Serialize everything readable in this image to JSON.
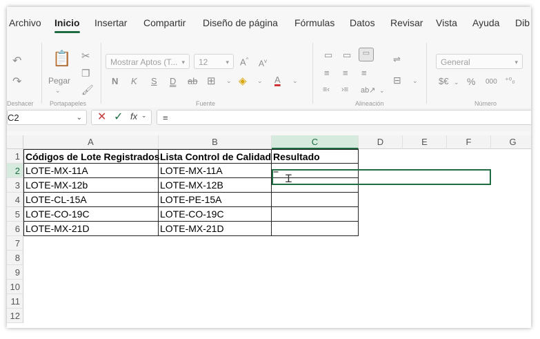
{
  "tabs": [
    "Archivo",
    "Inicio",
    "Insertar",
    "Compartir",
    "Diseño de página",
    "Fórmulas",
    "Datos",
    "Revisar",
    "Vista",
    "Ayuda",
    "Dib"
  ],
  "active_tab": "Inicio",
  "ribbon": {
    "undo_group_label": "Deshacer",
    "clipboard_group_label": "Portapapeles",
    "paste_label": "Pegar",
    "font_group_label": "Fuente",
    "font_name": "Mostrar Aptos (T...",
    "font_size": "12",
    "alignment_group_label": "Alineación",
    "number_group_label": "Número",
    "number_format": "General",
    "currency_label": "$€",
    "percent_label": "%",
    "thousands_label": "000"
  },
  "formula_bar": {
    "name_box": "C2",
    "formula": "="
  },
  "columns": [
    "A",
    "B",
    "C",
    "D",
    "E",
    "F",
    "G"
  ],
  "rows": [
    "1",
    "2",
    "3",
    "4",
    "5",
    "6",
    "7",
    "8",
    "9",
    "10",
    "11",
    "12"
  ],
  "sheet": {
    "headers": [
      "Códigos de Lote Registrados",
      "Lista Control de Calidad",
      "Resultado"
    ],
    "col_a": [
      "LOTE-MX-11A",
      "LOTE-MX-12b",
      "LOTE-CL-15A",
      "LOTE-CO-19C",
      "LOTE-MX-21D"
    ],
    "col_b": [
      "LOTE-MX-11A",
      "LOTE-MX-12B",
      "LOTE-PE-15A",
      "LOTE-CO-19C",
      "LOTE-MX-21D"
    ],
    "active_cell_value": "="
  },
  "colors": {
    "accent": "#1e6c41",
    "selected_header": "#d6ebdd"
  }
}
